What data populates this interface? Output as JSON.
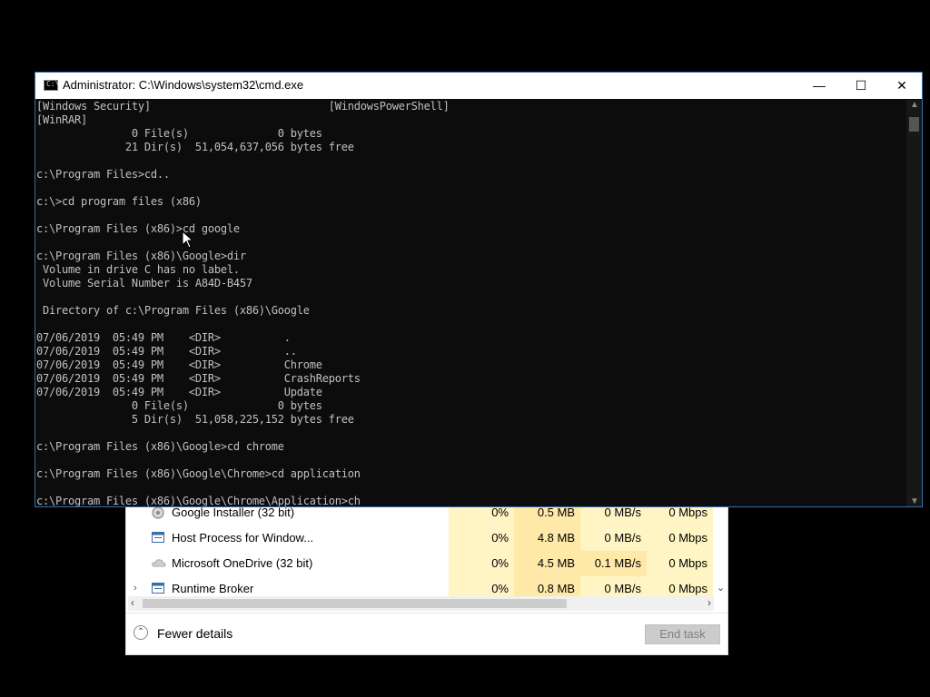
{
  "cmd_window": {
    "title": "Administrator: C:\\Windows\\system32\\cmd.exe",
    "icon": "cmd-icon",
    "icon_text": "C:\\",
    "minimize_glyph": "—",
    "maximize_glyph": "☐",
    "close_glyph": "✕",
    "lines": [
      "[Windows Security]                            [WindowsPowerShell]",
      "[WinRAR]",
      "               0 File(s)              0 bytes",
      "              21 Dir(s)  51,054,637,056 bytes free",
      "",
      "c:\\Program Files>cd..",
      "",
      "c:\\>cd program files (x86)",
      "",
      "c:\\Program Files (x86)>cd google",
      "",
      "c:\\Program Files (x86)\\Google>dir",
      " Volume in drive C has no label.",
      " Volume Serial Number is A84D-B457",
      "",
      " Directory of c:\\Program Files (x86)\\Google",
      "",
      "07/06/2019  05:49 PM    <DIR>          .",
      "07/06/2019  05:49 PM    <DIR>          ..",
      "07/06/2019  05:49 PM    <DIR>          Chrome",
      "07/06/2019  05:49 PM    <DIR>          CrashReports",
      "07/06/2019  05:49 PM    <DIR>          Update",
      "               0 File(s)              0 bytes",
      "               5 Dir(s)  51,058,225,152 bytes free",
      "",
      "c:\\Program Files (x86)\\Google>cd chrome",
      "",
      "c:\\Program Files (x86)\\Google\\Chrome>cd application",
      ""
    ],
    "current_input": "c:\\Program Files (x86)\\Google\\Chrome\\Application>ch"
  },
  "task_manager": {
    "rows": [
      {
        "name": "Google Installer (32 bit)",
        "cpu": "0%",
        "memory": "0.5 MB",
        "disk": "0 MB/s",
        "network": "0 Mbps",
        "expandable": false,
        "icon": "installer-icon"
      },
      {
        "name": "Host Process for Window...",
        "cpu": "0%",
        "memory": "4.8 MB",
        "disk": "0 MB/s",
        "network": "0 Mbps",
        "expandable": false,
        "icon": "window-process-icon"
      },
      {
        "name": "Microsoft OneDrive (32 bit)",
        "cpu": "0%",
        "memory": "4.5 MB",
        "disk": "0.1 MB/s",
        "network": "0 Mbps",
        "expandable": false,
        "icon": "onedrive-cloud-icon"
      },
      {
        "name": "Runtime Broker",
        "cpu": "0%",
        "memory": "0.8 MB",
        "disk": "0 MB/s",
        "network": "0 Mbps",
        "expandable": true,
        "icon": "window-process-icon"
      }
    ],
    "fewer_details_label": "Fewer details",
    "end_task_label": "End task"
  }
}
